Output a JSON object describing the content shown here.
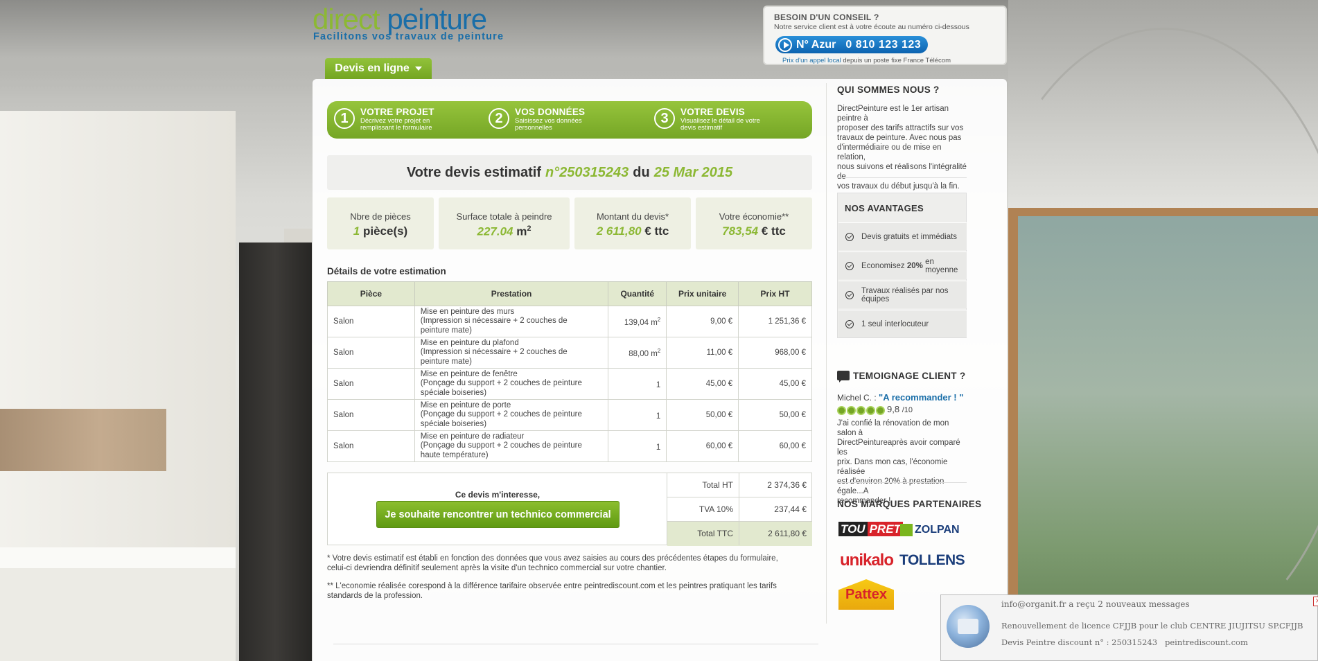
{
  "logo": {
    "part1": "direct",
    "part2": "peinture",
    "tagline": "Facilitons vos travaux de peinture"
  },
  "advice": {
    "title": "BESOIN D'UN CONSEIL ?",
    "subtitle": "Notre service client est à votre écoute au numéro ci-dessous",
    "azur_label": "N° Azur",
    "phone": "0 810 123 123",
    "foot_link": "Prix d'un appel local",
    "foot_rest": "depuis un poste fixe France Télécom"
  },
  "tab": {
    "label": "Devis en ligne"
  },
  "steps": [
    {
      "num": "1",
      "title": "VOTRE PROJET",
      "desc": "Décrivez votre projet en remplissant le formulaire"
    },
    {
      "num": "2",
      "title": "VOS DONNÉES",
      "desc": "Saisissez vos données personnelles"
    },
    {
      "num": "3",
      "title": "VOTRE DEVIS",
      "desc": "Visualisez le détail de votre devis estimatif"
    }
  ],
  "quote": {
    "prefix": "Votre devis estimatif",
    "number": "n°250315243",
    "du": "du",
    "date": "25 Mar 2015"
  },
  "stats": [
    {
      "label": "Nbre de pièces",
      "value": "1",
      "unit": "pièce(s)"
    },
    {
      "label": "Surface totale à peindre",
      "value": "227.04",
      "unit": "m",
      "sup": "2"
    },
    {
      "label": "Montant du devis*",
      "value": "2 611,80",
      "unit": "€ ttc"
    },
    {
      "label": "Votre économie**",
      "value": "783,54",
      "unit": "€ ttc"
    }
  ],
  "details": {
    "title": "Détails de votre estimation",
    "headers": [
      "Pièce",
      "Prestation",
      "Quantité",
      "Prix unitaire",
      "Prix HT"
    ],
    "rows": [
      {
        "piece": "Salon",
        "l1": "Mise en peinture des murs",
        "l2": "(Impression si nécessaire + 2 couches de",
        "l3": "peinture mate)",
        "qty": "139,04 m",
        "qsup": "2",
        "pu": "9,00 €",
        "ht": "1 251,36 €"
      },
      {
        "piece": "Salon",
        "l1": "Mise en peinture du plafond",
        "l2": "(Impression si nécessaire + 2 couches de",
        "l3": "peinture mate)",
        "qty": "88,00 m",
        "qsup": "2",
        "pu": "11,00 €",
        "ht": "968,00 €"
      },
      {
        "piece": "Salon",
        "l1": "Mise en peinture de fenêtre",
        "l2": "(Ponçage du support + 2 couches de peinture",
        "l3": "spéciale boiseries)",
        "qty": "1",
        "qsup": "",
        "pu": "45,00 €",
        "ht": "45,00 €"
      },
      {
        "piece": "Salon",
        "l1": "Mise en peinture de porte",
        "l2": "(Ponçage du support + 2 couches de peinture",
        "l3": "spéciale boiseries)",
        "qty": "1",
        "qsup": "",
        "pu": "50,00 €",
        "ht": "50,00 €"
      },
      {
        "piece": "Salon",
        "l1": "Mise en peinture de radiateur",
        "l2": "(Ponçage du support + 2 couches de peinture",
        "l3": "haute température)",
        "qty": "1",
        "qsup": "",
        "pu": "60,00 €",
        "ht": "60,00 €"
      }
    ]
  },
  "totals": {
    "interest": "Ce devis m'interesse,",
    "button": "Je souhaite rencontrer un technico commercial",
    "rows": [
      {
        "label": "Total HT",
        "value": "2 374,36 €"
      },
      {
        "label": "TVA 10%",
        "value": "237,44 €"
      },
      {
        "label": "Total TTC",
        "value": "2 611,80 €"
      }
    ]
  },
  "notes": {
    "n1a": "* Votre devis estimatif est établi en fonction des données que vous avez saisies au cours des précédentes étapes du formulaire,",
    "n1b": "celui-ci devriendra définitif seulement après la visite d'un technico commercial sur votre chantier.",
    "n2a": "** L'economie réalisée corespond à la différence tarifaire observée entre peintrediscount.com et les peintres pratiquant les tarifs",
    "n2b": "standards de la profession."
  },
  "sidebar": {
    "about_title": "QUI SOMMES NOUS ?",
    "about_lines": [
      "DirectPeinture est le 1er artisan peintre à",
      "proposer des tarifs attractifs sur vos",
      "travaux de peinture. Avec nous pas",
      "d'intermédiaire ou de mise en relation,",
      "nous suivons et réalisons l'intégralité de",
      "vos travaux du début jusqu'à la fin."
    ],
    "adv_title": "NOS AVANTAGES",
    "adv_items": [
      {
        "pre": "Devis gratuits et immédiats",
        "bold": "",
        "post": ""
      },
      {
        "pre": "Economisez ",
        "bold": "20%",
        "post": " en moyenne"
      },
      {
        "pre": "Travaux réalisés par nos équipes",
        "bold": "",
        "post": ""
      },
      {
        "pre": "1 seul interlocuteur",
        "bold": "",
        "post": ""
      }
    ],
    "testi_title": "TEMOIGNAGE CLIENT ?",
    "testi_author": "Michel C. :",
    "testi_quote": "\"A recommander ! \"",
    "testi_score": "9,8",
    "testi_max": "/10",
    "testi_rating": 5,
    "testi_lines": [
      "J'ai confié la rénovation de mon salon à",
      "DirectPeintureaprès avoir comparé les",
      "prix. Dans mon cas, l'économie réalisée",
      "est d'environ 20% à prestation égale...A",
      "recommander !"
    ],
    "brands_title": "NOS MARQUES PARTENAIRES",
    "brands": [
      "TOUPRET",
      "ZOLPAN",
      "unikalo",
      "TOLLENS",
      "Pattex"
    ]
  },
  "notification": {
    "title": "info@organit.fr a reçu 2 nouveaux messages",
    "m1": "Renouvellement de licence CFJJB pour le club CENTRE JIUJITSU SP...",
    "m1_from": "CFJJB",
    "m2": "Devis Peintre discount n° : 250315243",
    "m2_from": "peintrediscount.com",
    "close": "×"
  },
  "colors": {
    "green": "#8cb834",
    "blue": "#1a6ea8",
    "azur": "#0c63b0"
  }
}
